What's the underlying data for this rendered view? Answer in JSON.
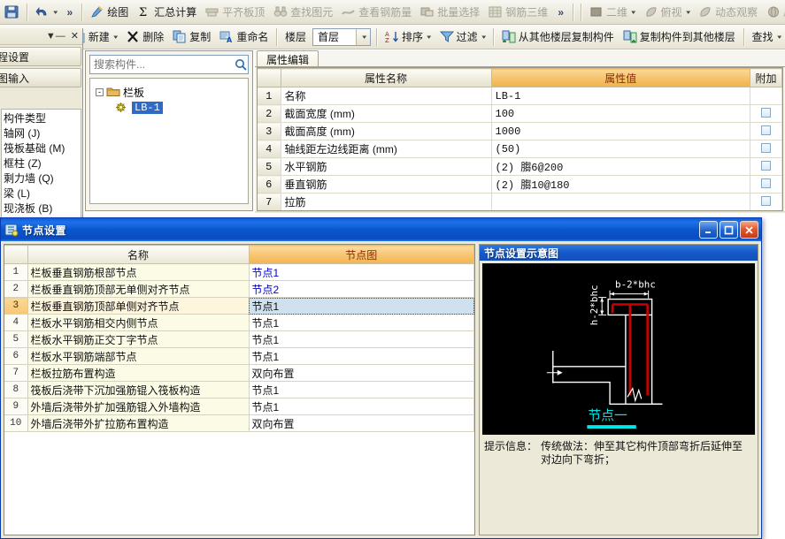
{
  "toolbar_row1": {
    "left_group": [
      {
        "name": "save",
        "icon": "save-icon",
        "label": ""
      },
      {
        "name": "undo",
        "icon": "undo-icon",
        "label": "",
        "caret": true
      },
      {
        "name": "overflow",
        "icon": "",
        "label": "»"
      }
    ],
    "main_group": [
      {
        "name": "draw",
        "icon": "draw-icon",
        "label": "绘图",
        "dim": false
      },
      {
        "name": "summary-calc",
        "icon": "sigma-icon",
        "label": "汇总计算",
        "dim": false
      },
      {
        "name": "flush-slab-top",
        "icon": "flush-icon",
        "label": "平齐板顶",
        "dim": true
      },
      {
        "name": "find-element",
        "icon": "binoculars-icon",
        "label": "查找图元",
        "dim": true
      },
      {
        "name": "view-rebar-qty",
        "icon": "rebar-icon",
        "label": "查看钢筋量",
        "dim": true
      },
      {
        "name": "batch-select",
        "icon": "batch-icon",
        "label": "批量选择",
        "dim": true
      },
      {
        "name": "rebar-3d",
        "icon": "rebar3d-icon",
        "label": "钢筋三维",
        "dim": true
      },
      {
        "name": "overflow2",
        "icon": "",
        "label": "»",
        "dim": false
      }
    ],
    "view_group": [
      {
        "name": "view-2d",
        "icon": "square-icon",
        "label": "二维",
        "caret": true,
        "dim": true
      },
      {
        "name": "top-view",
        "icon": "leaf-icon",
        "label": "俯视",
        "caret": true,
        "dim": true
      },
      {
        "name": "dynamic-observe",
        "icon": "leaf-icon",
        "label": "动态观察",
        "dim": true
      },
      {
        "name": "local-view",
        "icon": "sphere-icon",
        "label": "局部",
        "dim": true
      }
    ]
  },
  "toolbar_row2": {
    "items": [
      {
        "name": "new",
        "icon": "new-icon",
        "label": "新建",
        "caret": true
      },
      {
        "name": "delete",
        "icon": "x-icon",
        "label": "删除"
      },
      {
        "name": "copy",
        "icon": "copy-icon",
        "label": "复制"
      },
      {
        "name": "rename",
        "icon": "rename-icon",
        "label": "重命名"
      }
    ],
    "floor_label": "楼层",
    "floor_value": "首层",
    "items2": [
      {
        "name": "sort",
        "icon": "sort-az-icon",
        "label": "排序",
        "caret": true
      },
      {
        "name": "filter",
        "icon": "funnel-icon",
        "label": "过滤",
        "caret": true
      }
    ],
    "items3": [
      {
        "name": "copy-from-other-floor",
        "icon": "copy-from-icon",
        "label": "从其他楼层复制构件"
      },
      {
        "name": "copy-to-other-floor",
        "icon": "copy-to-icon",
        "label": "复制构件到其他楼层"
      }
    ],
    "find_label": "查找",
    "find_caret": true
  },
  "sidebar": {
    "pin_icon": "pin-icon",
    "close_icon": "close-icon",
    "buttons": [
      {
        "name": "project-settings",
        "label": "程设置"
      },
      {
        "name": "drawing-input",
        "label": "图输入"
      }
    ],
    "tree_header": "构件类型",
    "tree_items": [
      {
        "name": "axis-net",
        "label": "轴网 (J)"
      },
      {
        "name": "raft-foundation",
        "label": "筏板基础 (M)"
      },
      {
        "name": "frame-column",
        "label": "框柱 (Z)"
      },
      {
        "name": "shear-wall",
        "label": "剩力墙 (Q)"
      },
      {
        "name": "beam",
        "label": "梁 (L)"
      },
      {
        "name": "cast-slab",
        "label": "现浇板 (B)"
      }
    ]
  },
  "component_panel": {
    "search_placeholder": "搜索构件...",
    "search_value": "",
    "search_icon": "search-icon",
    "tree": {
      "root_label": "栏板",
      "root_expander": "-",
      "child_label": "LB-1",
      "child_selected": true
    }
  },
  "property_editor": {
    "tab_label": "属性编辑",
    "columns": [
      "",
      "属性名称",
      "属性值",
      "附加"
    ],
    "rows": [
      {
        "idx": "1",
        "name": "名称",
        "value": "LB-1",
        "link": true,
        "attach": false
      },
      {
        "idx": "2",
        "name": "截面宽度 (mm)",
        "value": "100",
        "link": true,
        "attach": true
      },
      {
        "idx": "3",
        "name": "截面高度 (mm)",
        "value": "1000",
        "link": true,
        "attach": true
      },
      {
        "idx": "4",
        "name": "轴线距左边线距离 (mm)",
        "value": "(50)",
        "link": false,
        "attach": true
      },
      {
        "idx": "5",
        "name": "水平钢筋",
        "value": "(2) 䐢6@200",
        "link": true,
        "attach": true
      },
      {
        "idx": "6",
        "name": "垂直钢筋",
        "value": "(2) 䐢10@180",
        "link": true,
        "attach": true
      },
      {
        "idx": "7",
        "name": "拉筋",
        "value": "",
        "link": true,
        "attach": true
      }
    ]
  },
  "dialog": {
    "title": "节点设置",
    "icon": "node-settings-icon",
    "window_buttons": [
      {
        "name": "minimize-button",
        "glyph": "_"
      },
      {
        "name": "maximize-button",
        "glyph": "□"
      },
      {
        "name": "close-button",
        "glyph": "✕"
      }
    ],
    "list": {
      "columns": [
        "",
        "名称",
        "节点图"
      ],
      "rows": [
        {
          "idx": "1",
          "name": "栏板垂直钢筋根部节点",
          "node": "节点1",
          "link": true,
          "selected": false
        },
        {
          "idx": "2",
          "name": "栏板垂直钢筋顶部无单侧对齐节点",
          "node": "节点2",
          "link": true,
          "selected": false
        },
        {
          "idx": "3",
          "name": "栏板垂直钢筋顶部单侧对齐节点",
          "node": "节点1",
          "link": false,
          "selected": true
        },
        {
          "idx": "4",
          "name": "栏板水平钢筋相交内侧节点",
          "node": "节点1",
          "link": false,
          "selected": false
        },
        {
          "idx": "5",
          "name": "栏板水平钢筋正交丁字节点",
          "node": "节点1",
          "link": false,
          "selected": false
        },
        {
          "idx": "6",
          "name": "栏板水平钢筋端部节点",
          "node": "节点1",
          "link": false,
          "selected": false
        },
        {
          "idx": "7",
          "name": "栏板拉筋布置构造",
          "node": "双向布置",
          "link": false,
          "selected": false
        },
        {
          "idx": "8",
          "name": "筏板后浇带下沉加强筋锟入筏板构造",
          "node": "节点1",
          "link": false,
          "selected": false
        },
        {
          "idx": "9",
          "name": "外墙后浇带外扩加强筋锟入外墙构造",
          "node": "节点1",
          "link": false,
          "selected": false
        },
        {
          "idx": "10",
          "name": "外墙后浇带外扩拉筋布置构造",
          "node": "双向布置",
          "link": false,
          "selected": false
        }
      ]
    },
    "preview": {
      "title": "节点设置示意图",
      "diagram": {
        "dim_top": "b-2*bhc",
        "dim_left": "h-2*bhc",
        "caption": "节点一",
        "rebar_color": "#cc0000",
        "outline_color": "#ffffff",
        "caption_color": "#00e5e5",
        "bg_color": "#000000"
      },
      "hint_label": "提示信息：",
      "hint_text": "传统做法：伸至其它构件顶部弯折后延伸至对边向下弯折；"
    }
  }
}
